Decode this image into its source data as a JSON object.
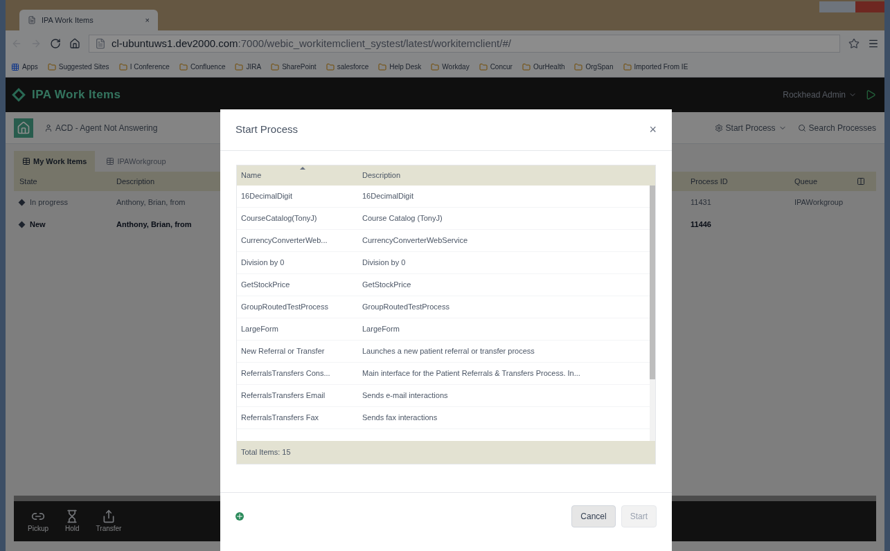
{
  "browser": {
    "tab_title": "IPA Work Items",
    "tab_close": "×",
    "url_host": "cl-ubuntuws1.dev2000.com",
    "url_path": ":7000/webic_workitemclient_systest/latest/workitemclient/#/",
    "bookmarks": [
      "Apps",
      "Suggested Sites",
      "I Conference",
      "Confluence",
      "JIRA",
      "SharePoint",
      "salesforce",
      "Help Desk",
      "Workday",
      "Concur",
      "OurHealth",
      "OrgSpan",
      "Imported From IE"
    ]
  },
  "app": {
    "title": "IPA Work Items",
    "user": "Rockhead Admin",
    "interaction": "ACD - Agent Not Answering",
    "actions": [
      "Start Process",
      "Search Processes"
    ],
    "tabs": [
      {
        "label": "My Work Items",
        "selected": true
      },
      {
        "label": "IPAWorkgroup",
        "selected": false
      }
    ],
    "columns": [
      "State",
      "Description",
      "Process ID",
      "Queue"
    ],
    "rows": [
      {
        "state": "In progress",
        "description": "Anthony, Brian, from",
        "process_id": "11431",
        "queue": "IPAWorkgroup",
        "unread": false
      },
      {
        "state": "New",
        "description": "Anthony, Brian, from",
        "process_id": "11446",
        "queue": "",
        "unread": true
      }
    ],
    "toolbar": [
      {
        "kind": "pickup",
        "label": "Pickup"
      },
      {
        "kind": "hold",
        "label": "Hold"
      },
      {
        "kind": "transfer",
        "label": "Transfer"
      }
    ]
  },
  "dialog": {
    "title": "Start Process",
    "close": "×",
    "columns": [
      "Name",
      "Description"
    ],
    "rows": [
      {
        "name": "16DecimalDigit",
        "description": "16DecimalDigit"
      },
      {
        "name": "CourseCatalog(TonyJ)",
        "description": "Course Catalog (TonyJ)"
      },
      {
        "name": "CurrencyConverterWeb...",
        "description": "CurrencyConverterWebService"
      },
      {
        "name": "Division by 0",
        "description": "Division by 0"
      },
      {
        "name": "GetStockPrice",
        "description": "GetStockPrice"
      },
      {
        "name": "GroupRoutedTestProcess",
        "description": "GroupRoutedTestProcess"
      },
      {
        "name": "LargeForm",
        "description": "LargeForm"
      },
      {
        "name": "New Referral or Transfer",
        "description": "Launches a new patient referral or transfer process"
      },
      {
        "name": "ReferralsTransfers Cons...",
        "description": "Main interface for the Patient Referrals & Transfers Process. In..."
      },
      {
        "name": "ReferralsTransfers Email",
        "description": "Sends e-mail interactions"
      },
      {
        "name": "ReferralsTransfers Fax",
        "description": "Sends fax interactions"
      }
    ],
    "total": "Total Items: 15",
    "buttons": [
      {
        "label": "Cancel",
        "disabled": false
      },
      {
        "label": "Start",
        "disabled": true
      }
    ]
  }
}
